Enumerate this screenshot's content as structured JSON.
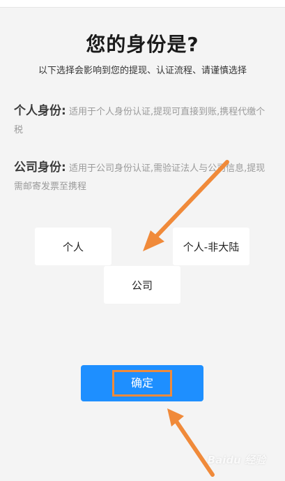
{
  "page": {
    "title": "您的身份是?",
    "subtitle": "以下选择会影响到您的提现、认证流程、请谨慎选择"
  },
  "descriptions": [
    {
      "label": "个人身份:",
      "text": "适用于个人身份认证,提现可直接到账,携程代缴个税"
    },
    {
      "label": "公司身份:",
      "text": "适用于公司身份认证,需验证法人与公司信息,提现需邮寄发票至携程"
    }
  ],
  "options": [
    {
      "label": "个人"
    },
    {
      "label": "个人-非大陆"
    },
    {
      "label": "公司"
    }
  ],
  "confirm": {
    "label": "确定"
  },
  "watermark": {
    "text": "Baidu 经验"
  },
  "colors": {
    "primary": "#1e8fff",
    "annotation": "#f08a3a",
    "background": "#f4f4f4"
  }
}
